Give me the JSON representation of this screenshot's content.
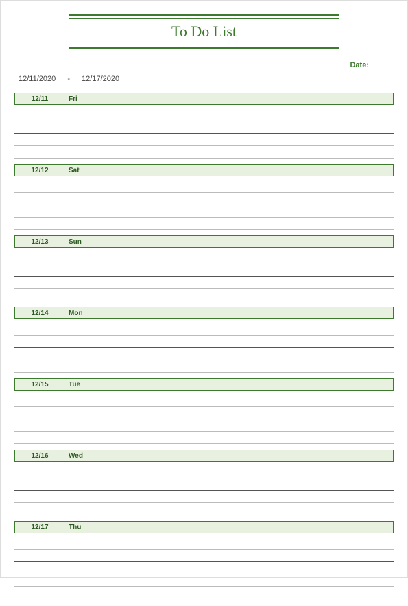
{
  "title": "To Do List",
  "date_label": "Date:",
  "range": {
    "start": "12/11/2020",
    "separator": "-",
    "end": "12/17/2020"
  },
  "days": [
    {
      "date": "12/11",
      "dow": "Fri"
    },
    {
      "date": "12/12",
      "dow": "Sat"
    },
    {
      "date": "12/13",
      "dow": "Sun"
    },
    {
      "date": "12/14",
      "dow": "Mon"
    },
    {
      "date": "12/15",
      "dow": "Tue"
    },
    {
      "date": "12/16",
      "dow": "Wed"
    },
    {
      "date": "12/17",
      "dow": "Thu"
    }
  ]
}
